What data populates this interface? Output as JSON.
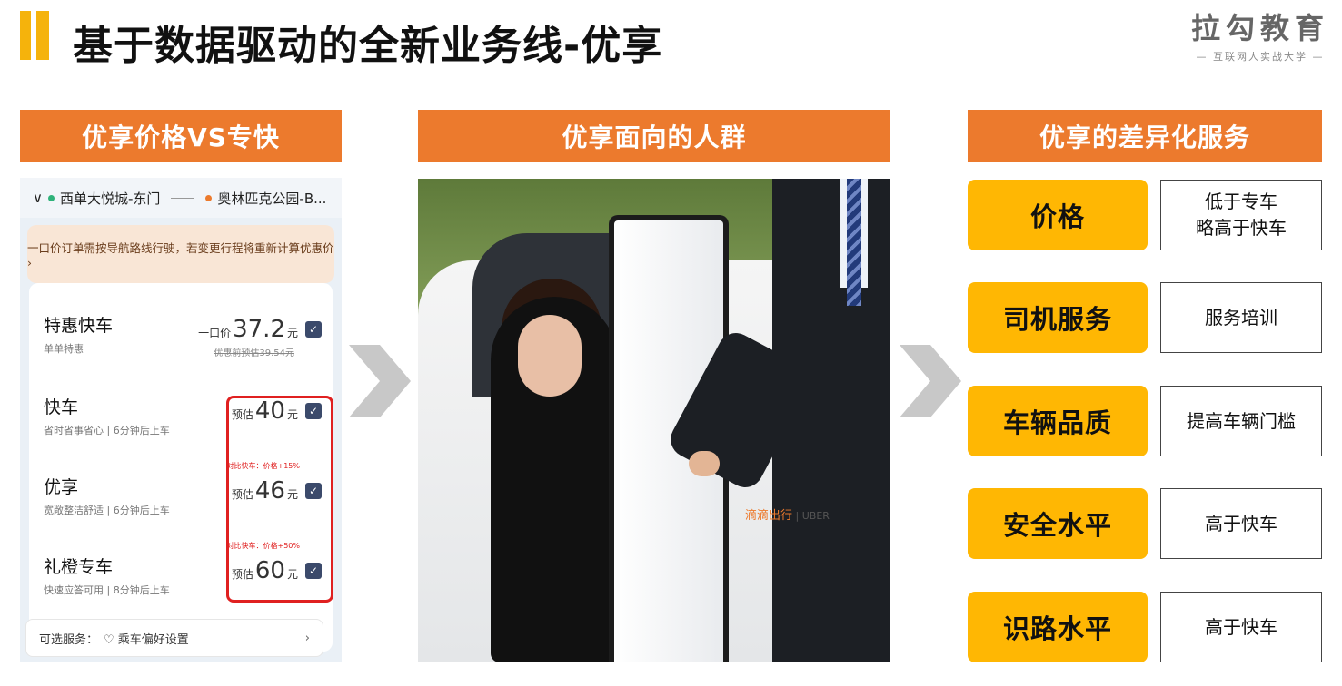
{
  "header": {
    "title": "基于数据驱动的全新业务线-优享"
  },
  "logo": {
    "name": "拉勾教育",
    "tagline": "— 互联网人实战大学 —"
  },
  "sections": {
    "price_vs": "优享价格VS专快",
    "audience": "优享面向的人群",
    "services": "优享的差异化服务"
  },
  "phone": {
    "route_from": "西单大悦城-东门",
    "route_to": "奥林匹克公园-B...",
    "route_chevron": "∨",
    "notice": "一口价订单需按导航路线行驶，若变更行程将重新计算优惠价 ›",
    "options": [
      {
        "name": "特惠快车",
        "sub": "单单特惠",
        "price_prefix": "一口价",
        "price": "37.2",
        "unit": "元",
        "strike": "优惠前预估39.54元",
        "note": ""
      },
      {
        "name": "快车",
        "sub": "省时省事省心 | 6分钟后上车",
        "price_prefix": "预估",
        "price": "40",
        "unit": "元",
        "strike": "",
        "note": ""
      },
      {
        "name": "优享",
        "sub": "宽敞整洁舒适 | 6分钟后上车",
        "price_prefix": "预估",
        "price": "46",
        "unit": "元",
        "strike": "",
        "note": "对比快车：价格+15%"
      },
      {
        "name": "礼橙专车",
        "sub": "快速应答可用 | 8分钟后上车",
        "price_prefix": "预估",
        "price": "60",
        "unit": "元",
        "strike": "",
        "note": "对比快车：价格+50%"
      }
    ],
    "optional_label": "可选服务：",
    "optional_value": "♡ 乘车偏好设置",
    "optional_chevron": "›"
  },
  "photo": {
    "brand_cn": "滴滴出行",
    "brand_en": "UBER"
  },
  "services": [
    {
      "label": "价格",
      "value_line1": "低于专车",
      "value_line2": "略高于快车"
    },
    {
      "label": "司机服务",
      "value_line1": "服务培训",
      "value_line2": ""
    },
    {
      "label": "车辆品质",
      "value_line1": "提高车辆门槛",
      "value_line2": ""
    },
    {
      "label": "安全水平",
      "value_line1": "高于快车",
      "value_line2": ""
    },
    {
      "label": "识路水平",
      "value_line1": "高于快车",
      "value_line2": ""
    }
  ],
  "colors": {
    "accent_yellow": "#F5B30C",
    "header_orange": "#EC7A2D",
    "label_yellow": "#FFB703",
    "highlight_red": "#E02020"
  }
}
